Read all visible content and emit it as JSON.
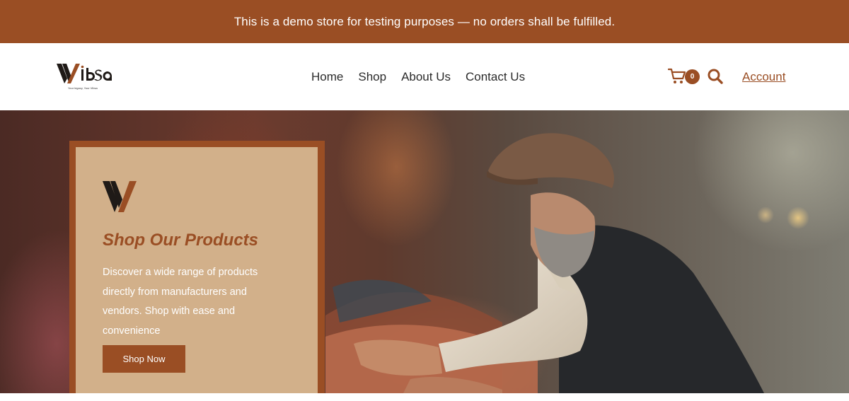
{
  "banner": {
    "text": "This is a demo store for testing purposes — no orders shall be fulfilled."
  },
  "header": {
    "logo_text": "Vibsa",
    "logo_tagline": "Your legacy, Your Vibsa",
    "nav": [
      {
        "label": "Home"
      },
      {
        "label": "Shop"
      },
      {
        "label": "About Us"
      },
      {
        "label": "Contact Us"
      }
    ],
    "cart_count": "0",
    "account_label": "Account"
  },
  "hero": {
    "title": "Shop Our Products",
    "description": "Discover a wide range of products directly from manufacturers and vendors. Shop with ease and convenience",
    "cta_label": "Shop Now"
  },
  "theme": {
    "accent": "#9a4e24",
    "card_background": "#d2b08a"
  },
  "icons": [
    "cart-icon",
    "search-icon",
    "brand-v-mark-icon"
  ]
}
